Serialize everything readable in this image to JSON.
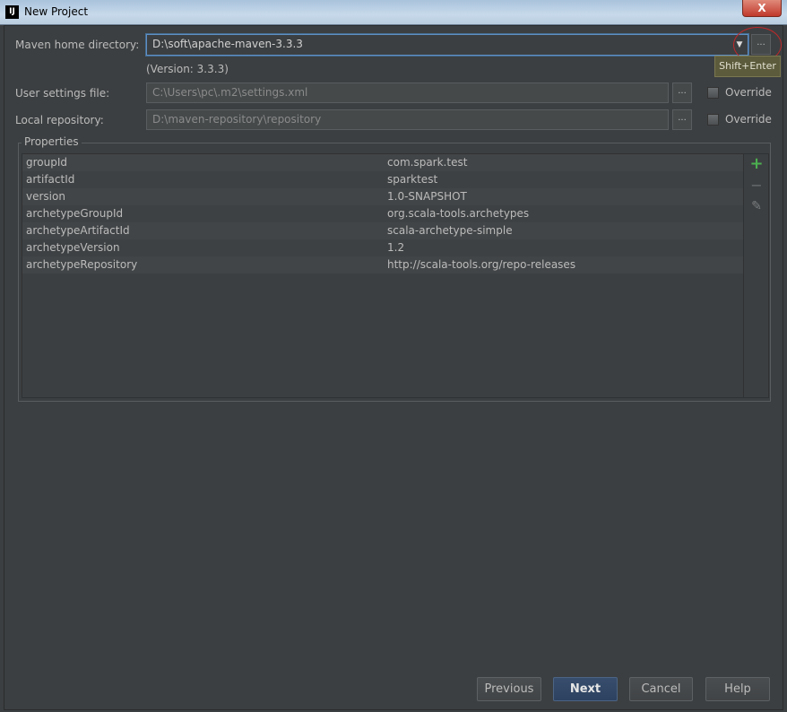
{
  "window": {
    "title": "New Project",
    "logo": "IJ",
    "close": "X"
  },
  "form": {
    "maven_home_label": "Maven home directory:",
    "maven_home_value": "D:\\soft\\apache-maven-3.3.3",
    "version": "(Version: 3.3.3)",
    "tooltip": "Shift+Enter",
    "user_settings_label": "User settings file:",
    "user_settings_value": "C:\\Users\\pc\\.m2\\settings.xml",
    "local_repo_label": "Local repository:",
    "local_repo_value": "D:\\maven-repository\\repository",
    "override_label": "Override",
    "browse": "...",
    "dropdown": "▼"
  },
  "properties": {
    "legend": "Properties",
    "rows": [
      {
        "key": "groupId",
        "value": "com.spark.test"
      },
      {
        "key": "artifactId",
        "value": "sparktest"
      },
      {
        "key": "version",
        "value": "1.0-SNAPSHOT"
      },
      {
        "key": "archetypeGroupId",
        "value": "org.scala-tools.archetypes"
      },
      {
        "key": "archetypeArtifactId",
        "value": "scala-archetype-simple"
      },
      {
        "key": "archetypeVersion",
        "value": "1.2"
      },
      {
        "key": "archetypeRepository",
        "value": "http://scala-tools.org/repo-releases"
      }
    ],
    "icons": {
      "add": "+",
      "remove": "−",
      "edit": "✎"
    },
    "add_color": "#4caf50"
  },
  "buttons": {
    "previous": "Previous",
    "next": "Next",
    "cancel": "Cancel",
    "help": "Help"
  }
}
